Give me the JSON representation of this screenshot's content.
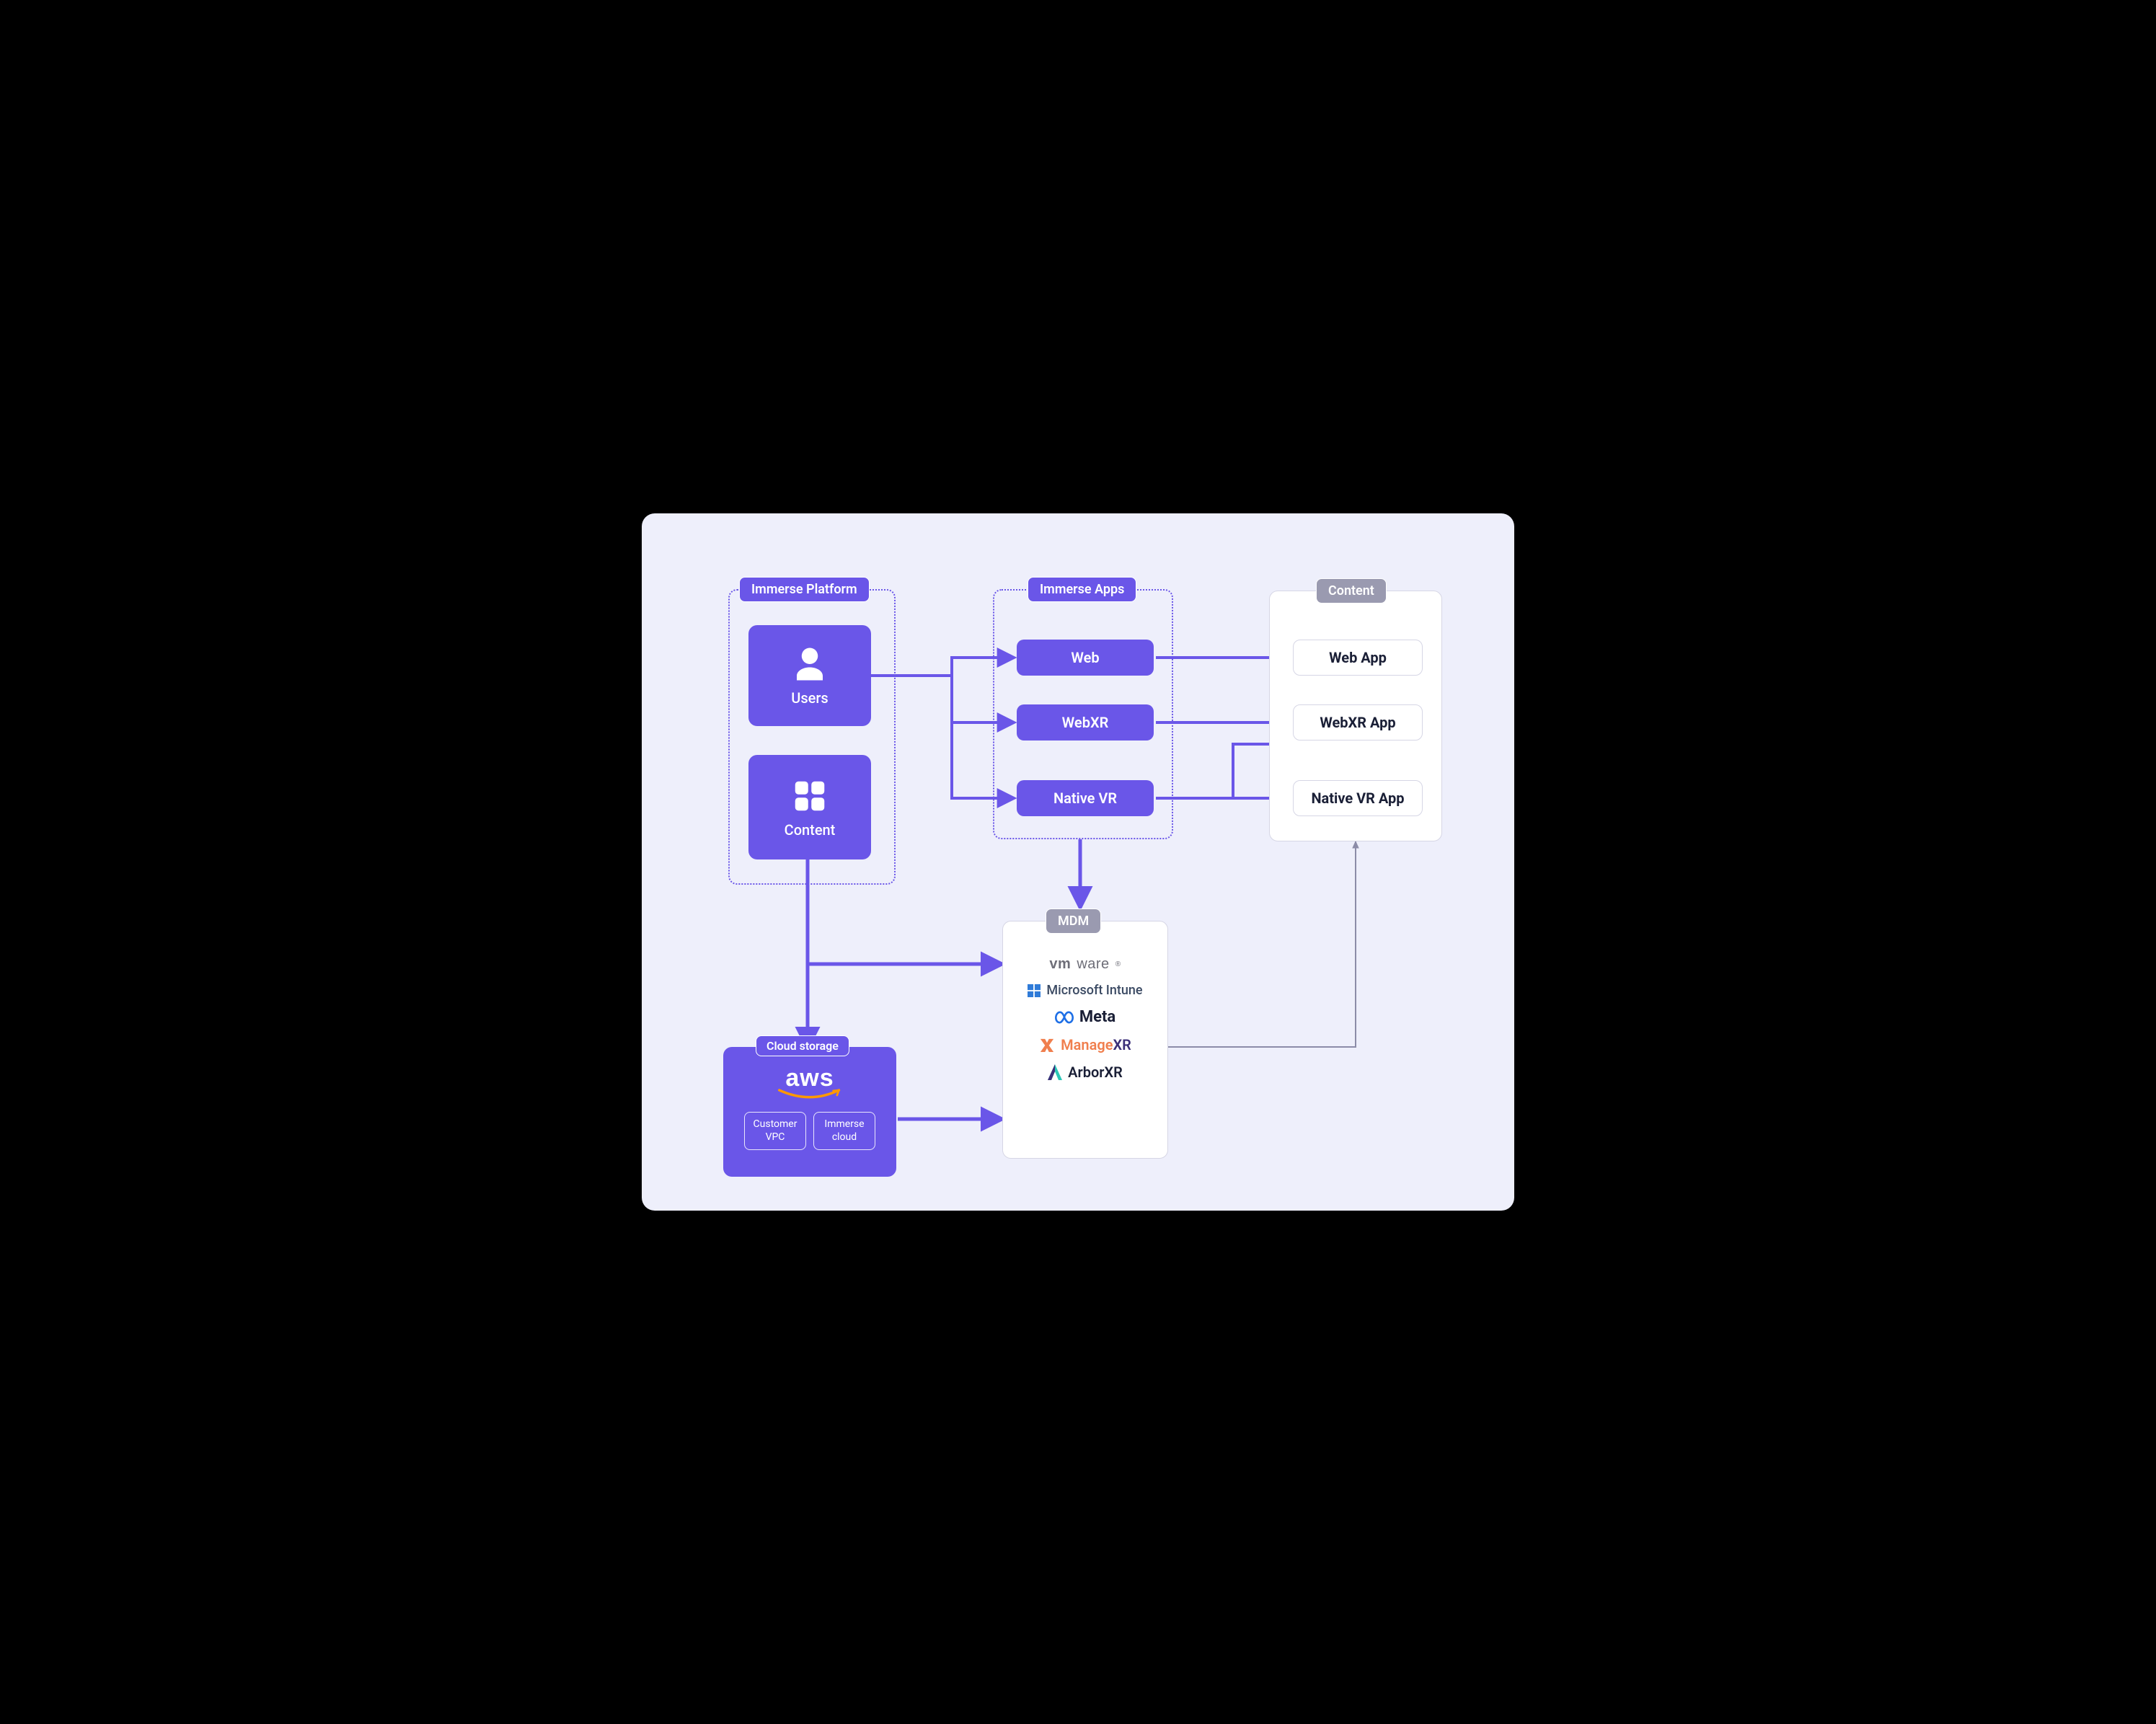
{
  "sections": {
    "platform": {
      "title": "Immerse Platform",
      "users": "Users",
      "content": "Content"
    },
    "apps": {
      "title": "Immerse Apps",
      "web": "Web",
      "webxr": "WebXR",
      "nativevr": "Native VR"
    },
    "content": {
      "title": "Content",
      "web": "Web App",
      "webxr": "WebXR App",
      "nativevr": "Native VR App"
    },
    "mdm": {
      "title": "MDM",
      "vmware": "vmware",
      "vmware_r": "®",
      "intune": "Microsoft Intune",
      "meta": "Meta",
      "managexr_a": "Manage",
      "managexr_b": "XR",
      "arbor": "ArborXR"
    },
    "storage": {
      "title": "Cloud storage",
      "aws": "aws",
      "vpc": "Customer\nVPC",
      "cloud": "Immerse\ncloud"
    }
  },
  "colors": {
    "accent": "#6A56E8"
  }
}
